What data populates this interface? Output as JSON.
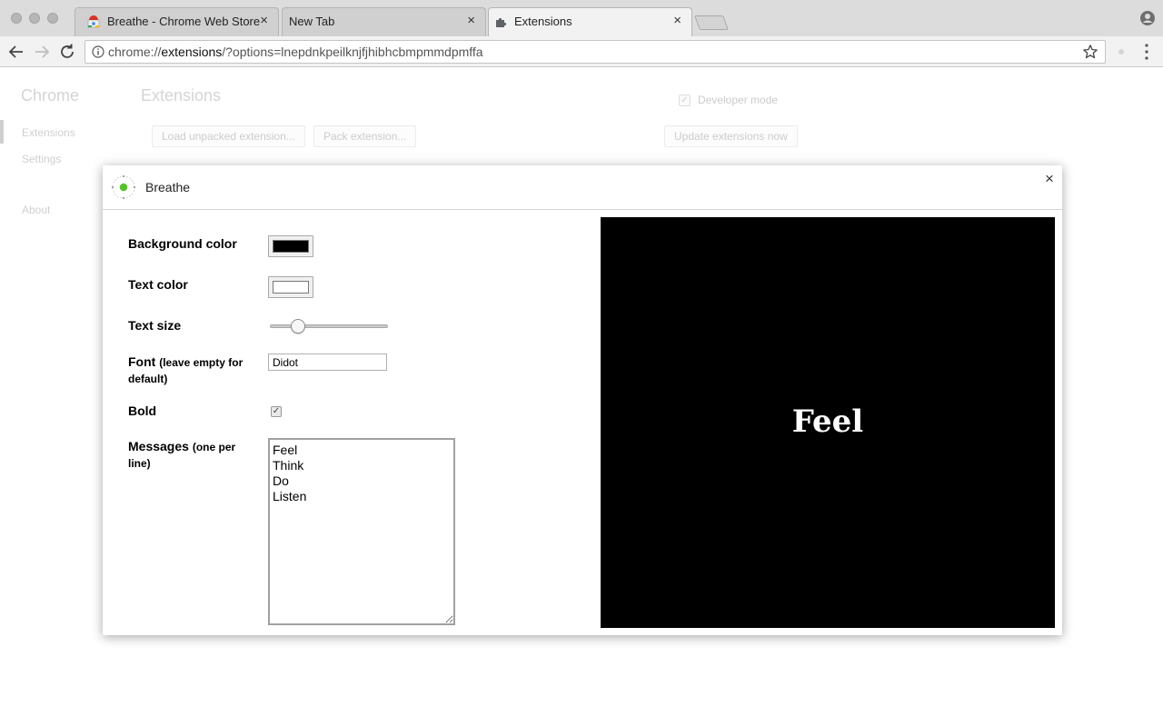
{
  "window": {
    "tabs": [
      {
        "title": "Breathe - Chrome Web Store",
        "favicon": "chrome-web-store-icon"
      },
      {
        "title": "New Tab",
        "favicon": ""
      },
      {
        "title": "Extensions",
        "favicon": "puzzle-piece-icon"
      }
    ],
    "tab_close_glyph": "×"
  },
  "toolbar": {
    "url_scheme": "chrome://",
    "url_host": "extensions",
    "url_rest": "/?options=lnepdnkpeilknjfjhibhcbmpmmdpmffa"
  },
  "page": {
    "brand": "Chrome",
    "sidebar": [
      {
        "label": "Extensions"
      },
      {
        "label": "Settings"
      },
      {
        "label": "About"
      }
    ],
    "title": "Extensions",
    "developer_mode_label": "Developer mode",
    "developer_mode_checked": true,
    "check_glyph": "✓",
    "buttons": {
      "load_unpacked": "Load unpacked extension...",
      "pack": "Pack extension...",
      "update": "Update extensions now"
    }
  },
  "dialog": {
    "title": "Breathe",
    "close_glyph": "×",
    "fields": {
      "background_color_label": "Background color",
      "background_color": "#000000",
      "text_color_label": "Text color",
      "text_color": "#ffffff",
      "text_size_label": "Text size",
      "text_size_fraction": 0.2,
      "font_label": "Font",
      "font_sub": "(leave empty for default)",
      "font_value": "Didot",
      "bold_label": "Bold",
      "bold_checked": true,
      "messages_label": "Messages",
      "messages_sub": "(one per line)",
      "messages_value": "Feel\nThink\nDo\nListen"
    },
    "preview_word": "Feel"
  }
}
